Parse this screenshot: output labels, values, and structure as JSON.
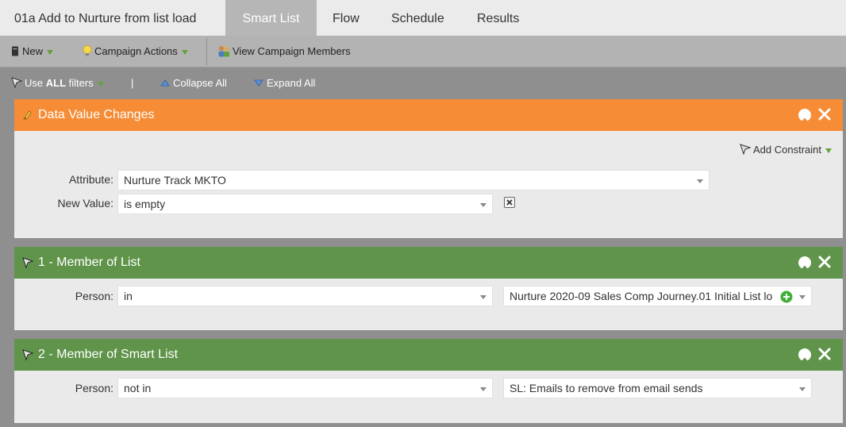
{
  "tabs": {
    "program_title": "01a Add to Nurture from list load",
    "smart_list": "Smart List",
    "flow": "Flow",
    "schedule": "Schedule",
    "results": "Results"
  },
  "toolbar": {
    "new_label": "New",
    "campaign_actions_label": "Campaign Actions",
    "view_members_label": "View Campaign Members"
  },
  "filterbar": {
    "use_prefix": "Use ",
    "use_bold": "ALL",
    "use_suffix": " filters",
    "separator": "|",
    "collapse_label": "Collapse All",
    "expand_label": "Expand All"
  },
  "trigger": {
    "title": "Data Value Changes",
    "add_constraint_label": "Add Constraint",
    "attribute_label": "Attribute:",
    "attribute_value": "Nurture Track MKTO",
    "new_value_label": "New Value:",
    "new_value_value": "is empty"
  },
  "filters": [
    {
      "title": "1 - Member of List",
      "person_label": "Person:",
      "operator": "in",
      "value": "Nurture 2020-09 Sales Comp Journey.01 Initial List lo"
    },
    {
      "title": "2 - Member of Smart List",
      "person_label": "Person:",
      "operator": "not in",
      "value": "SL: Emails to remove from email sends"
    }
  ],
  "colors": {
    "trigger_header": "#f68c35",
    "filter_header": "#5f944a",
    "add_green": "#3fae35"
  },
  "icons": {
    "new": "document-icon",
    "campaign_actions": "lightbulb-icon",
    "view_members": "people-icon",
    "filters": "funnel-icon",
    "collapse": "triangle-up-icon",
    "expand": "triangle-down-icon",
    "trigger": "lightning-icon",
    "move_up": "arrow-up-circle-icon",
    "remove": "close-icon",
    "add": "plus-circle-icon"
  }
}
